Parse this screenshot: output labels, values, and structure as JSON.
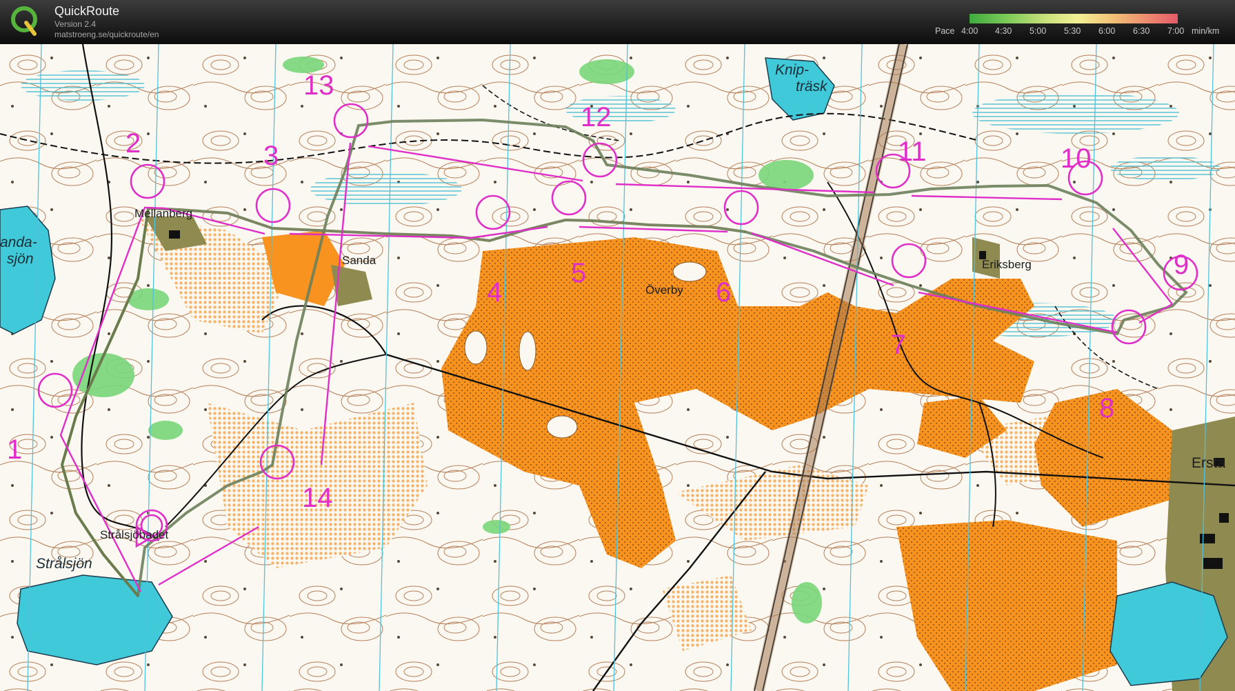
{
  "app": {
    "title": "QuickRoute",
    "version": "Version 2.4",
    "url": "matstroeng.se/quickroute/en"
  },
  "pace_legend": {
    "label": "Pace",
    "ticks": [
      "4:00",
      "4:30",
      "5:00",
      "5:30",
      "6:00",
      "6:30",
      "7:00"
    ],
    "unit": "min/km",
    "colors": [
      "#3faa3f",
      "#7ccb58",
      "#c8e07a",
      "#f3f094",
      "#f2c377",
      "#ee8f6f",
      "#e35b69"
    ]
  },
  "map": {
    "controls": [
      "1",
      "2",
      "3",
      "4",
      "5",
      "6",
      "7",
      "8",
      "9",
      "10",
      "11",
      "12",
      "13",
      "14"
    ],
    "place_names": [
      "Mellanberg",
      "Sanda",
      "Överby",
      "Eriksberg",
      "Strålsjöbadet",
      "Ersta"
    ],
    "lake_names": [
      "anda-",
      "sjön",
      "Knip-",
      "träsk",
      "Strålsjön"
    ],
    "colors": {
      "course": "#e02ec9",
      "field": "#f7931e",
      "water": "#3fc8d8",
      "forest_green": "#6bd26b",
      "contour": "#9a5a2a",
      "settlement": "#8f8a4f"
    }
  }
}
